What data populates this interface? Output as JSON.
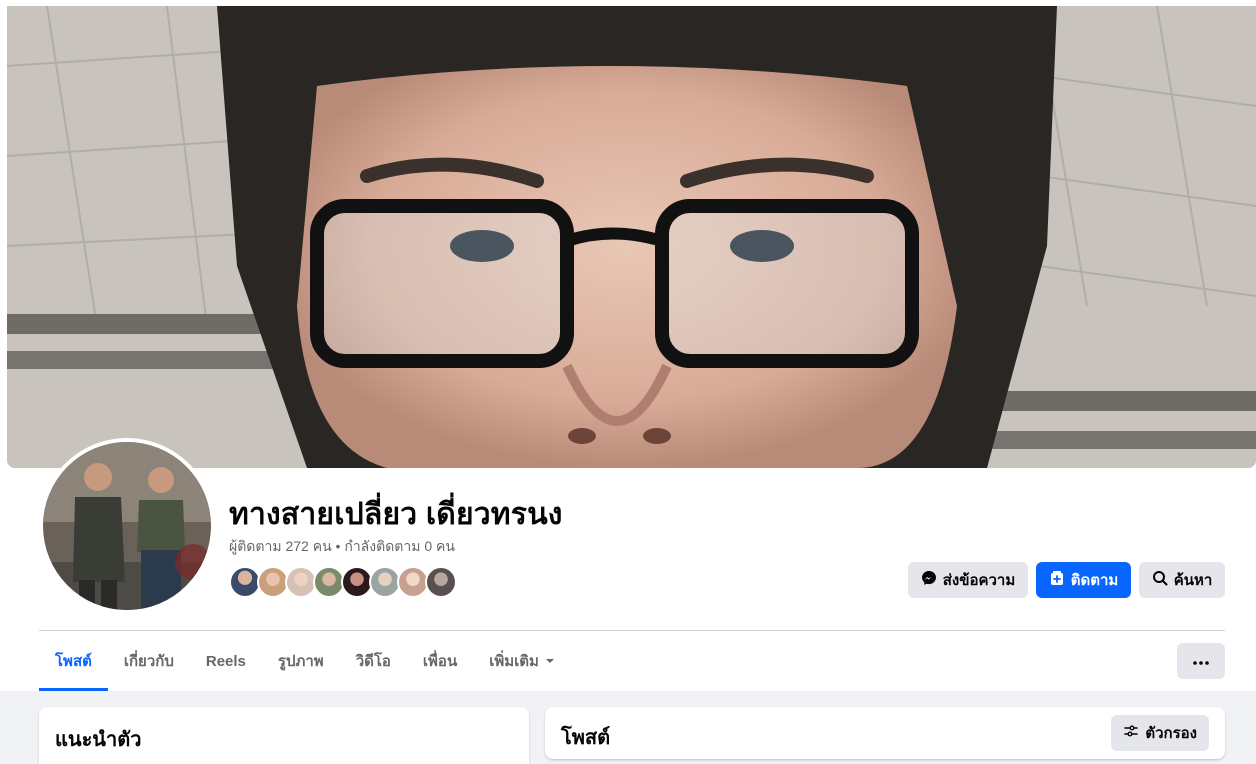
{
  "profile": {
    "name": "ทางสายเปลี่ยว เดี่ยวทรนง",
    "followers_label": "ผู้ติดตาม",
    "followers_count": "272",
    "unit": "คน",
    "separator": "•",
    "following_label": "กำลังติดตาม",
    "following_count": "0"
  },
  "actions": {
    "message_label": "ส่งข้อความ",
    "follow_label": "ติดตาม",
    "search_label": "ค้นหา"
  },
  "tabs": [
    {
      "label": "โพสต์",
      "active": true
    },
    {
      "label": "เกี่ยวกับ",
      "active": false
    },
    {
      "label": "Reels",
      "active": false
    },
    {
      "label": "รูปภาพ",
      "active": false
    },
    {
      "label": "วิดีโอ",
      "active": false
    },
    {
      "label": "เพื่อน",
      "active": false
    },
    {
      "label": "เพิ่มเติม",
      "active": false,
      "dropdown": true
    }
  ],
  "intro": {
    "title": "แนะนำตัว"
  },
  "posts": {
    "title": "โพสต์",
    "filter_label": "ตัวกรอง"
  },
  "colors": {
    "accent": "#0866ff",
    "secondary_button": "#e4e6eb",
    "muted_text": "#65676b",
    "page_bg": "#f0f2f5"
  },
  "icons": {
    "message": "messenger-icon",
    "follow": "follow-plus-icon",
    "search": "search-icon",
    "more": "more-dots-icon",
    "filter": "filter-sliders-icon",
    "dropdown": "caret-down-icon"
  }
}
